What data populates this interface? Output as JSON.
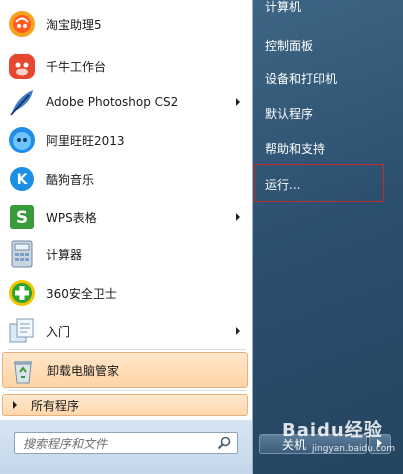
{
  "left": {
    "items": [
      {
        "label": "淘宝助理5",
        "icon": "taobao-assistant-icon"
      },
      {
        "label": "千牛工作台",
        "icon": "qianniu-icon"
      },
      {
        "label": "Adobe Photoshop CS2",
        "icon": "photoshop-feather-icon"
      },
      {
        "label": "阿里旺旺2013",
        "icon": "aliwangwang-icon"
      },
      {
        "label": "酷狗音乐",
        "icon": "kugou-icon"
      },
      {
        "label": "WPS表格",
        "icon": "wps-spreadsheet-icon"
      },
      {
        "label": "计算器",
        "icon": "calculator-icon"
      },
      {
        "label": "360安全卫士",
        "icon": "360-security-icon"
      },
      {
        "label": "入门",
        "icon": "getting-started-icon"
      },
      {
        "label": "卸载电脑管家",
        "icon": "recycle-bin-icon"
      }
    ],
    "all_programs": "所有程序",
    "search_placeholder": "搜索程序和文件"
  },
  "right": {
    "items": [
      {
        "label": "计算机"
      },
      {
        "label": "控制面板"
      },
      {
        "label": "设备和打印机"
      },
      {
        "label": "默认程序"
      },
      {
        "label": "帮助和支持"
      },
      {
        "label": "运行..."
      }
    ],
    "shutdown_label": "关机"
  },
  "watermark": {
    "brand": "Baidu经验",
    "url": "jingyan.baidu.com"
  },
  "colors": {
    "highlight": "#ffd4a6",
    "run_outline": "#c02b2b",
    "right_bg": "#2d5070"
  }
}
